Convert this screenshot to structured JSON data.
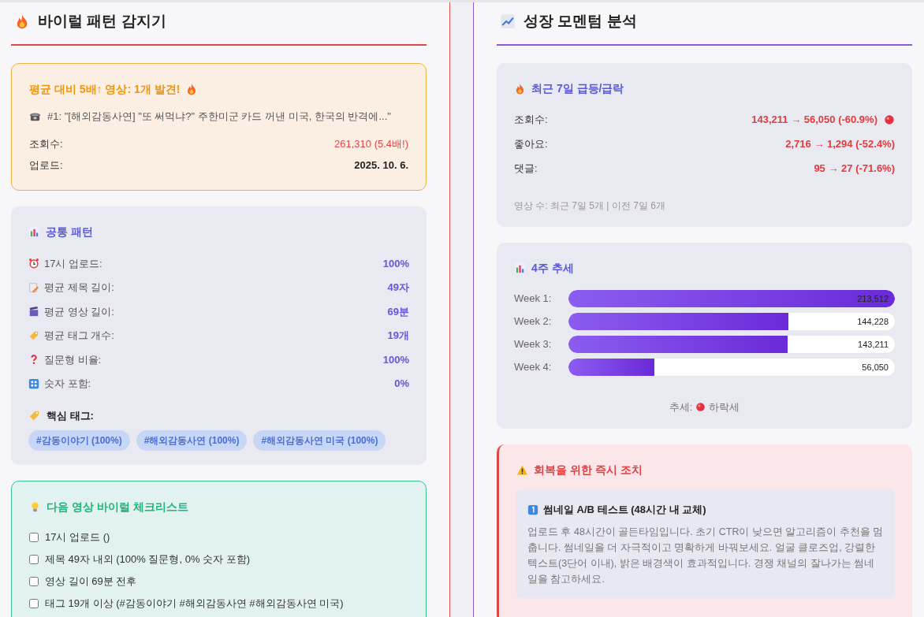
{
  "viral": {
    "title": "바이럴 패턴 감지기",
    "alert": {
      "title": "평균 대비 5배↑ 영상: 1개 발견!",
      "video": "#1: \"[해외감동사연] \"또 써먹냐?\" 주한미군 카드 꺼낸 미국, 한국의 반격에...\"",
      "rows": [
        {
          "label": "조회수:",
          "value": "261,310 (5.4배!)",
          "highlight": true
        },
        {
          "label": "업로드:",
          "value": "2025. 10. 6.",
          "highlight": false
        }
      ]
    },
    "patterns": {
      "title": "공통 패턴",
      "rows": [
        {
          "label": "17시 업로드:",
          "value": "100%"
        },
        {
          "label": "평균 제목 길이:",
          "value": "49자"
        },
        {
          "label": "평균 영상 길이:",
          "value": "69분"
        },
        {
          "label": "평균 태그 개수:",
          "value": "19개"
        },
        {
          "label": "질문형 비율:",
          "value": "100%"
        },
        {
          "label": "숫자 포함:",
          "value": "0%"
        }
      ],
      "tags_title": "핵심 태그:",
      "tags": [
        "#감동이야기 (100%)",
        "#해외감동사연 (100%)",
        "#해외감동사연 미국 (100%)"
      ]
    },
    "checklist": {
      "title": "다음 영상 바이럴 체크리스트",
      "items": [
        {
          "label": "17시 업로드 ()",
          "checked": false
        },
        {
          "label": "제목 49자 내외 (100% 질문형, 0% 숫자 포함)",
          "checked": false
        },
        {
          "label": "영상 길이 69분 전후",
          "checked": false
        },
        {
          "label": "태그 19개 이상 (#감동이야기 #해외감동사연 #해외감동사연 미국)",
          "checked": false
        }
      ]
    }
  },
  "momentum": {
    "title": "성장 모멘텀 분석",
    "recent": {
      "title": "최근 7일 급등/급락",
      "rows": [
        {
          "label": "조회수:",
          "value": "143,211 → 56,050 (-60.9%)",
          "dot": true
        },
        {
          "label": "좋아요:",
          "value": "2,716 → 1,294 (-52.4%)",
          "dot": false
        },
        {
          "label": "댓글:",
          "value": "95 → 27 (-71.6%)",
          "dot": false
        }
      ],
      "footer": "영상 수: 최근 7일 5개 | 이전 7일 6개"
    },
    "weekly": {
      "title": "4주 추세",
      "weeks": [
        {
          "label": "Week 1:",
          "value": "213,512",
          "level": 1
        },
        {
          "label": "Week 2:",
          "value": "144,228",
          "level": 0.675
        },
        {
          "label": "Week 3:",
          "value": "143,211",
          "level": 0.671
        },
        {
          "label": "Week 4:",
          "value": "56,050",
          "level": 0.263
        }
      ],
      "trend_label": "추세:",
      "trend": "하락세"
    },
    "actions": {
      "title": "회복을 위한 즉시 조치",
      "items": [
        {
          "title": "썸네일 A/B 테스트 (48시간 내 교체)",
          "text": "업로드 후 48시간이 골든타임입니다. 초기 CTR이 낮으면 알고리즘이 추천을 멈춥니다. 썸네일을 더 자극적이고 명확하게 바꿔보세요. 얼굴 클로즈업, 강렬한 텍스트(3단어 이내), 밝은 배경색이 효과적입니다. 경쟁 채널의 잘나가는 썸네일을 참고하세요."
        }
      ]
    }
  }
}
